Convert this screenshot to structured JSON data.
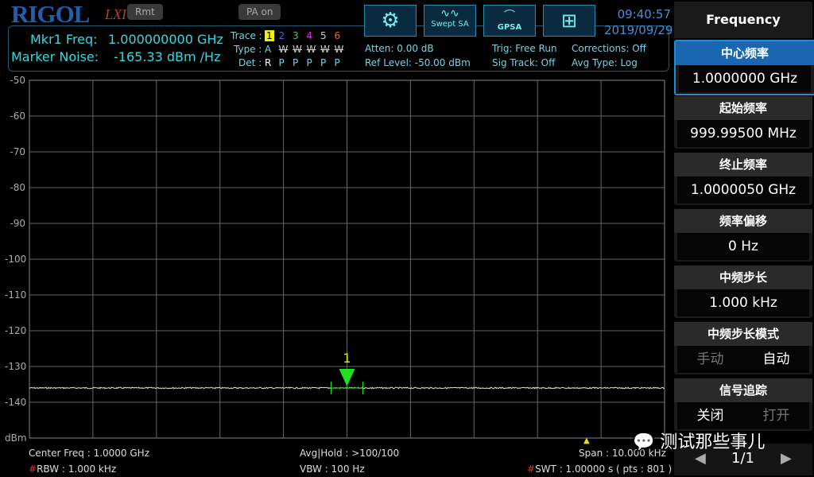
{
  "header": {
    "logo": "RIGOL",
    "lxi": "LXI",
    "rmt": "Rmt",
    "pa": "PA on",
    "time": "09:40:57",
    "date": "2019/09/29",
    "modes": [
      {
        "icon": "gear-icon",
        "label": ""
      },
      {
        "icon": "swept-sa-icon",
        "label": "Swept SA"
      },
      {
        "icon": "gpsa-icon",
        "label": "GPSA"
      },
      {
        "icon": "grid-icon",
        "label": ""
      }
    ]
  },
  "marker": {
    "freq_label": "Mkr1 Freq:",
    "freq_value": "1.000000000 GHz",
    "noise_label": "Marker Noise:",
    "noise_value": "-165.33 dBm /Hz",
    "number": "1"
  },
  "traces": {
    "trace_label": "Trace :",
    "type_label": "Type :",
    "det_label": "Det :",
    "ids": [
      "1",
      "2",
      "3",
      "4",
      "5",
      "6"
    ],
    "colors": [
      "#f0f000",
      "#5060e0",
      "#40d040",
      "#d040d0",
      "#d0d0d0",
      "#e07040"
    ],
    "types": [
      "A",
      "W",
      "W",
      "W",
      "W",
      "W"
    ],
    "dets": [
      "R",
      "P",
      "P",
      "P",
      "P",
      "P"
    ]
  },
  "status": {
    "atten": "Atten: 0.00 dB",
    "ref": "Ref Level: -50.00 dBm",
    "trig": "Trig: Free Run",
    "sigtrack": "Sig Track: Off",
    "corr": "Corrections: Off",
    "avgtype": "Avg Type: Log"
  },
  "softkeys": {
    "title": "Frequency",
    "items": [
      {
        "label": "中心频率",
        "value": "1.0000000 GHz",
        "active": true
      },
      {
        "label": "起始频率",
        "value": "999.99500 MHz"
      },
      {
        "label": "终止频率",
        "value": "1.0000050 GHz"
      },
      {
        "label": "频率偏移",
        "value": "0 Hz"
      },
      {
        "label": "中频步长",
        "value": "1.000 kHz"
      },
      {
        "label": "中频步长模式",
        "opt1": "手动",
        "opt2": "自动"
      },
      {
        "label": "信号追踪",
        "opt1": "关闭",
        "opt2": "打开"
      }
    ],
    "page": "1/1"
  },
  "footer": {
    "center": "Center Freq : 1.0000 GHz",
    "rbw_hash": "#",
    "rbw": "RBW : 1.000 kHz",
    "avg": "Avg|Hold : >100/100",
    "vbw": "VBW : 100 Hz",
    "span": "Span : 10.000 kHz",
    "swt_hash": "#",
    "swt": "SWT : 1.00000 s ( pts : 801 )"
  },
  "watermark": "测试那些事儿",
  "chart_data": {
    "type": "line",
    "ylabel": "dBm",
    "yticks": [
      "-50",
      "-60",
      "-70",
      "-80",
      "-90",
      "-100",
      "-110",
      "-120",
      "-130",
      "-140"
    ],
    "ylim": [
      -150,
      -50
    ],
    "xlim_hz": [
      999995000,
      1000005000
    ],
    "grid": true,
    "series": [
      {
        "color": "#e8e8c0",
        "noise_floor_dbm": -136
      }
    ],
    "marker": {
      "x_hz": 1000000000,
      "y_dbm": -136,
      "color": "#20e020"
    }
  }
}
